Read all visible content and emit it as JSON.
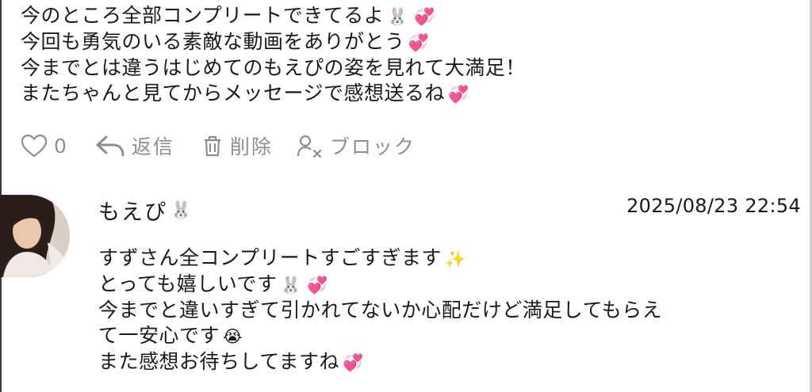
{
  "comment": {
    "lines": [
      {
        "text": "今のところ全部コンプリートできてるよ",
        "emoji": "🐰 💞"
      },
      {
        "text": "今回も勇気のいる素敵な動画をありがとう",
        "emoji": "💞"
      },
      {
        "text": "今までとは違うはじめてのもえぴの姿を見れて大満足！",
        "emoji": ""
      },
      {
        "text": "またちゃんと見てからメッセージで感想送るね",
        "emoji": "💞"
      }
    ],
    "actions": {
      "like_count": "0",
      "reply_label": "返信",
      "delete_label": "削除",
      "block_label": "ブロック"
    }
  },
  "reply": {
    "author": "もえぴ",
    "author_emoji": "🐰",
    "timestamp": "2025/08/23 22:54",
    "lines": [
      {
        "text": "すずさん全コンプリートすごすぎます",
        "emoji": "✨"
      },
      {
        "text": "とっても嬉しいです",
        "emoji": "🐰 💞"
      },
      {
        "text": "今までと違いすぎて引かれてないか心配だけど満足してもらえ",
        "emoji": ""
      },
      {
        "text": "て一安心です",
        "emoji": "😭"
      },
      {
        "text": "また感想お待ちしてますね",
        "emoji": "💞"
      }
    ]
  },
  "colors": {
    "text": "#1a1a1a",
    "muted": "#8e8e8e",
    "background": "#ffffff"
  }
}
